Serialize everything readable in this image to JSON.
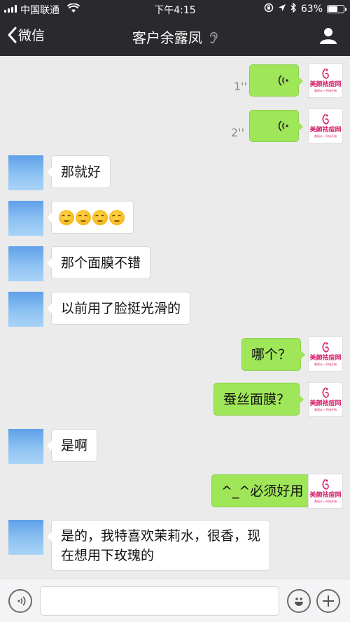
{
  "status_bar": {
    "carrier": "中国联通",
    "time": "下午4:15",
    "battery": "63%",
    "battery_level": 0.63
  },
  "nav": {
    "back_label": "微信",
    "title": "客户余露凤",
    "title_icon": "ear-icon",
    "profile_icon": "person-icon"
  },
  "brand": {
    "name": "美颜祛痘网",
    "slogan": "美丽从一开始开始"
  },
  "messages": [
    {
      "side": "right",
      "type": "voice",
      "duration": "1''"
    },
    {
      "side": "right",
      "type": "voice",
      "duration": "2''"
    },
    {
      "side": "left",
      "type": "text",
      "text": "那就好"
    },
    {
      "side": "left",
      "type": "emoji",
      "count": 4,
      "emoji": "smiling-face-icon"
    },
    {
      "side": "left",
      "type": "text",
      "text": "那个面膜不错"
    },
    {
      "side": "left",
      "type": "text",
      "text": "以前用了脸挺光滑的"
    },
    {
      "side": "right",
      "type": "text",
      "text": "哪个？"
    },
    {
      "side": "right",
      "type": "text",
      "text": "蚕丝面膜？"
    },
    {
      "side": "left",
      "type": "text",
      "text": "是啊"
    },
    {
      "side": "right",
      "type": "text",
      "text": "^_^必须好用"
    },
    {
      "side": "left",
      "type": "text",
      "lines": [
        "是的，我特喜欢茉莉水，很香，现",
        "在想用下玫瑰的"
      ]
    }
  ],
  "input_bar": {
    "voice_icon": "voice-icon",
    "emoji_icon": "emoji-icon",
    "add_icon": "plus-icon",
    "value": ""
  }
}
